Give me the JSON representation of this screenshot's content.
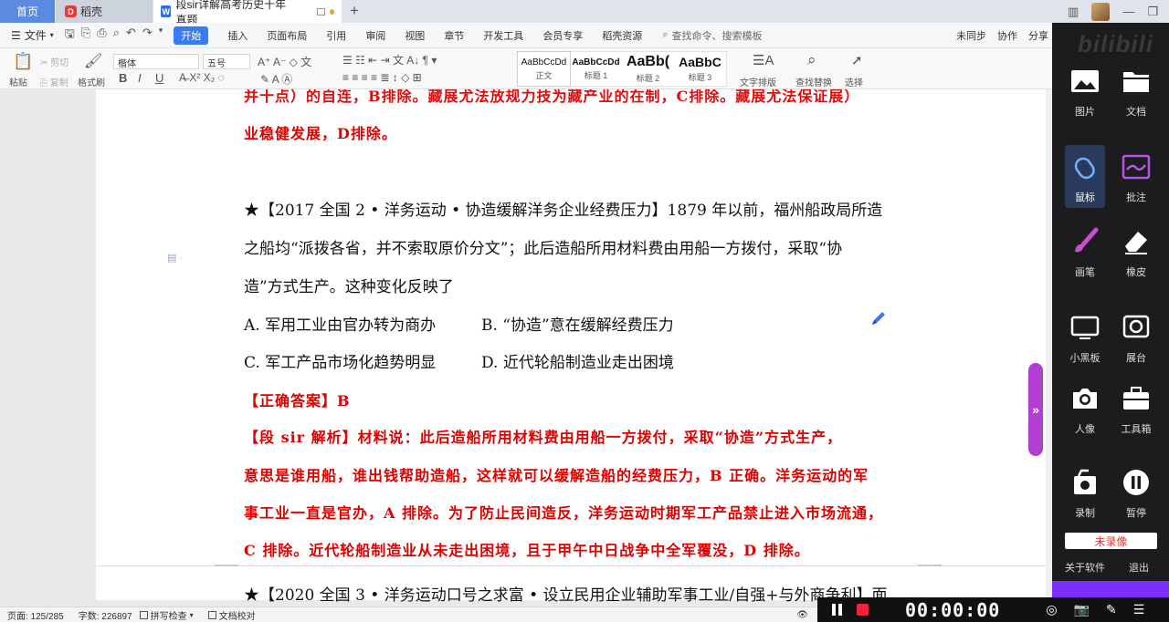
{
  "tabs": {
    "home": "首页",
    "daoke": "稻壳",
    "doc": "段sir详解高考历史十年真题"
  },
  "menubar": {
    "file": "文件",
    "items": [
      "开始",
      "插入",
      "页面布局",
      "引用",
      "审阅",
      "视图",
      "章节",
      "开发工具",
      "会员专享",
      "稻壳资源"
    ],
    "search_placeholder": "查找命令、搜索模板",
    "right": [
      "未同步",
      "协作",
      "分享"
    ]
  },
  "ribbon": {
    "paste": "粘贴",
    "cut": "剪切",
    "copy": "复制",
    "format_painter": "格式刷",
    "font_name": "楷体",
    "font_size": "五号",
    "styles": [
      {
        "sample": "AaBbCcDd",
        "label": "正文"
      },
      {
        "sample": "AaBbCcDd",
        "label": "标题 1"
      },
      {
        "sample": "AaBb(",
        "label": "标题 2"
      },
      {
        "sample": "AaBbC",
        "label": "标题 3"
      }
    ],
    "text_layout": "文字排版",
    "find_replace": "查找替换",
    "select": "选择"
  },
  "document": {
    "top_partial_1": "并十点）的自连，B排除。藏展尤法放规力技为藏产业的在制，C排除。藏展尤法保证展）",
    "top_partial_2": "业稳健发展，D排除。",
    "q1_line1": "★【2017 全国 2 • 洋务运动 • 协造缓解洋务企业经费压力】1879 年以前，福州船政局所造",
    "q1_line2": "之船均“派拨各省，并不索取原价分文”；此后造船所用材料费由用船一方拨付，采取“协",
    "q1_line3": "造”方式生产。这种变化反映了",
    "q1_optA": "A. 军用工业由官办转为商办",
    "q1_optB": "B. “协造”意在缓解经费压力",
    "q1_optC": "C. 军工产品市场化趋势明显",
    "q1_optD": "D. 近代轮船制造业走出困境",
    "answer": "【正确答案】B",
    "exp1": "【段 sir 解析】材料说：此后造船所用材料费由用船一方拨付，采取“协造”方式生产，",
    "exp2": "意思是谁用船，谁出钱帮助造船，这样就可以缓解造船的经费压力，B 正确。洋务运动的军",
    "exp3": "事工业一直是官办，A 排除。为了防止民间造反，洋务运动时期军工产品禁止进入市场流通，",
    "exp4": "C 排除。近代轮船制造业从未走出困境，且于甲午中日战争中全军覆没，D 排除。",
    "q2_line1": "★【2020 全国 3 • 洋务运动口号之求富 • 设立民用企业辅助军事工业/自强+与外商争利】面"
  },
  "statusbar": {
    "page": "页面: 125/285",
    "words": "字数: 226897",
    "spell": "拼写检查",
    "proof": "文档校对"
  },
  "recorder": {
    "time": "00:00:00"
  },
  "panel": {
    "watermark": "bilibili",
    "tools": [
      "图片",
      "文档",
      "鼠标",
      "批注",
      "画笔",
      "橡皮",
      "小黑板",
      "展台",
      "人像",
      "工具箱",
      "录制",
      "暂停"
    ],
    "status": "未录像",
    "about": "关于软件",
    "exit": "退出"
  },
  "colors": {
    "accent": "#3a7cf0",
    "answer_red": "#e00000",
    "handle_purple": "#b23ed2",
    "panel_bg": "#1c1c1e"
  }
}
